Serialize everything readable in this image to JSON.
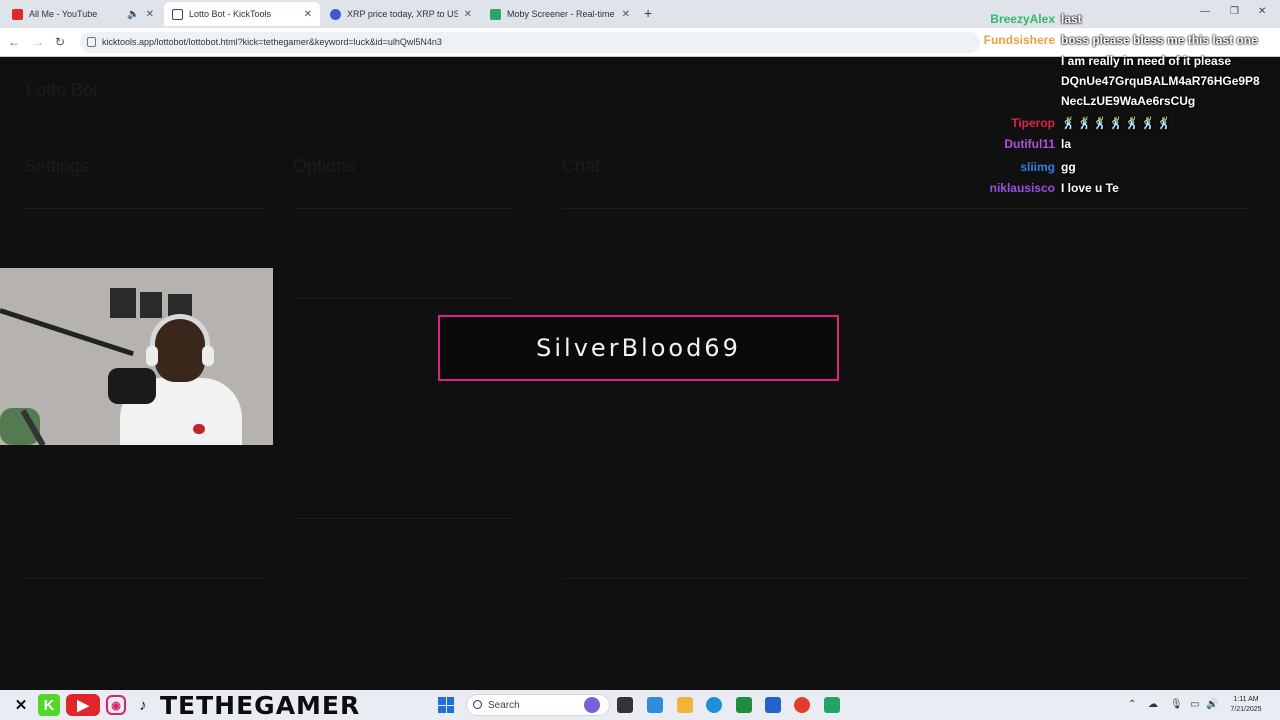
{
  "browser": {
    "tabs": [
      {
        "title": "All Me - YouTube",
        "favicon_color": "#e0262b",
        "active": false,
        "muted": true
      },
      {
        "title": "Lotto Bot - KickTools",
        "favicon_color": "#3a3a3a",
        "active": true,
        "muted": false
      },
      {
        "title": "XRP price today, XRP to USD li",
        "favicon_color": "#3b5bd6",
        "active": false,
        "muted": false
      },
      {
        "title": "Moby Screener - Real-time trac",
        "favicon_color": "#2fa36a",
        "active": false,
        "muted": false
      }
    ],
    "new_tab": "+",
    "url": "kicktools.app/lottobot/lottobot.html?kick=tethegamer&keyword=luck&id=ulhQwl5N4n3"
  },
  "page": {
    "faded_labels": {
      "title": "Lotto Bot",
      "settings": "Settings",
      "options": "Options",
      "chat": "Chat"
    }
  },
  "popup": {
    "winner": "SilverBlood69",
    "border_color": "#e0207f"
  },
  "chat": [
    {
      "user": "BreezyAlex",
      "user_color": "#33b96a",
      "message": "last"
    },
    {
      "user": "Fundsishere",
      "user_color": "#e6a23c",
      "message": "boss please bless me this last one"
    },
    {
      "user": "",
      "user_color": "#ffffff",
      "message": "I am really in need of it please"
    },
    {
      "user": "",
      "user_color": "#ffffff",
      "message": "DQnUe47GrquBALM4aR76HGe9P8"
    },
    {
      "user": "",
      "user_color": "#ffffff",
      "message": "NecLzUE9WaAe6rsCUg"
    },
    {
      "user": "Tiperop",
      "user_color": "#e0224a",
      "message": "🕺🕺🕺🕺🕺🕺🕺"
    },
    {
      "user": "Dutiful11",
      "user_color": "#b04fe0",
      "message": "la"
    },
    {
      "user": "sliimg",
      "user_color": "#2f7fe0",
      "message": "gg"
    },
    {
      "user": "niklausisco",
      "user_color": "#9a4fe0",
      "message": "I love u Te"
    }
  ],
  "taskbar": {
    "brand": "TETHEGAMER",
    "search_placeholder": "Search",
    "time": "1:11 AM",
    "date": "7/21/2025"
  }
}
